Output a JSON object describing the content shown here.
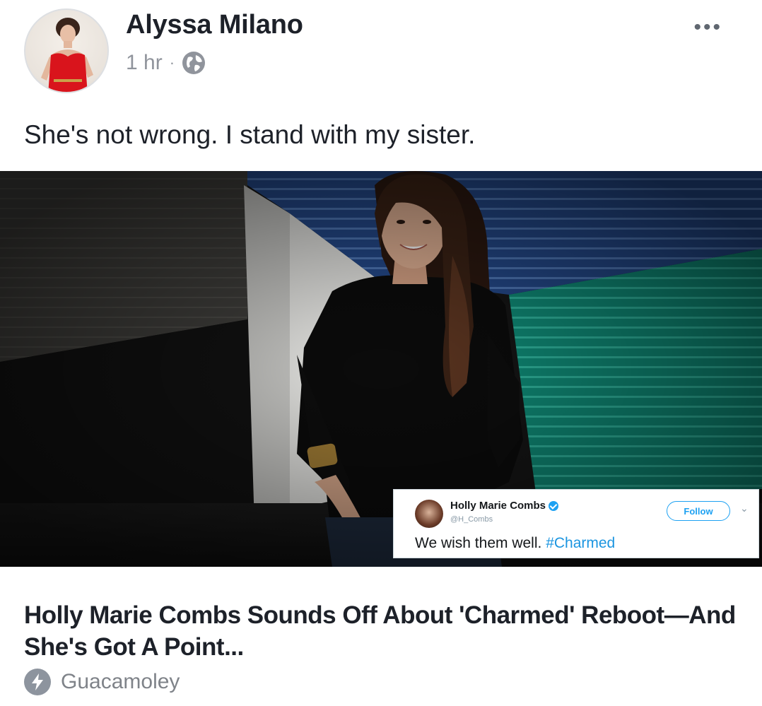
{
  "post": {
    "author": "Alyssa Milano",
    "time": "1 hr",
    "separator": "·",
    "privacy_icon": "globe-icon",
    "more_label": "•••",
    "status_text": "She's not wrong. I stand with my sister."
  },
  "tweet": {
    "name": "Holly Marie Combs",
    "handle": "@H_Combs",
    "follow_label": "Follow",
    "caret": "⌄",
    "text": "We wish them well.",
    "hashtag": "#Charmed",
    "hashtag_color": "#1b95e0",
    "verified_color": "#1da1f2"
  },
  "link": {
    "title": "Holly Marie Combs Sounds Off About 'Charmed' Reboot—And She's Got A Point...",
    "source": "Guacamoley",
    "source_icon": "bolt-icon"
  },
  "colors": {
    "text_primary": "#1d2129",
    "text_secondary": "#90949c"
  }
}
